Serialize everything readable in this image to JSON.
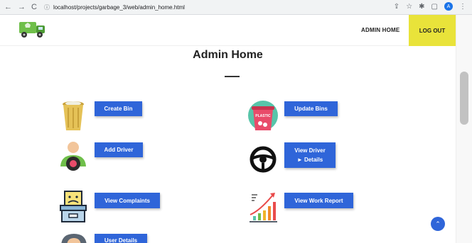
{
  "browser": {
    "back": "←",
    "forward": "→",
    "reload": "C",
    "url": "localhost/projects/garbage_3/web/admin_home.html",
    "profile_initial": "A"
  },
  "header": {
    "admin_home": "ADMIN HOME",
    "logout": "LOG OUT"
  },
  "main": {
    "title": "Admin Home",
    "buttons": {
      "create_bin": "Create Bin",
      "update_bins": "Update Bins",
      "add_driver": "Add Driver",
      "view_driver_line1": "View Driver",
      "view_driver_line2": "► Details",
      "view_complaints": "View Complaints",
      "view_work_report": "View Work Report",
      "user_details": "User Details"
    },
    "plastic_label": "PLASTIC"
  },
  "colors": {
    "accent": "#2f65d9",
    "logout_bg": "#e9e33a"
  }
}
